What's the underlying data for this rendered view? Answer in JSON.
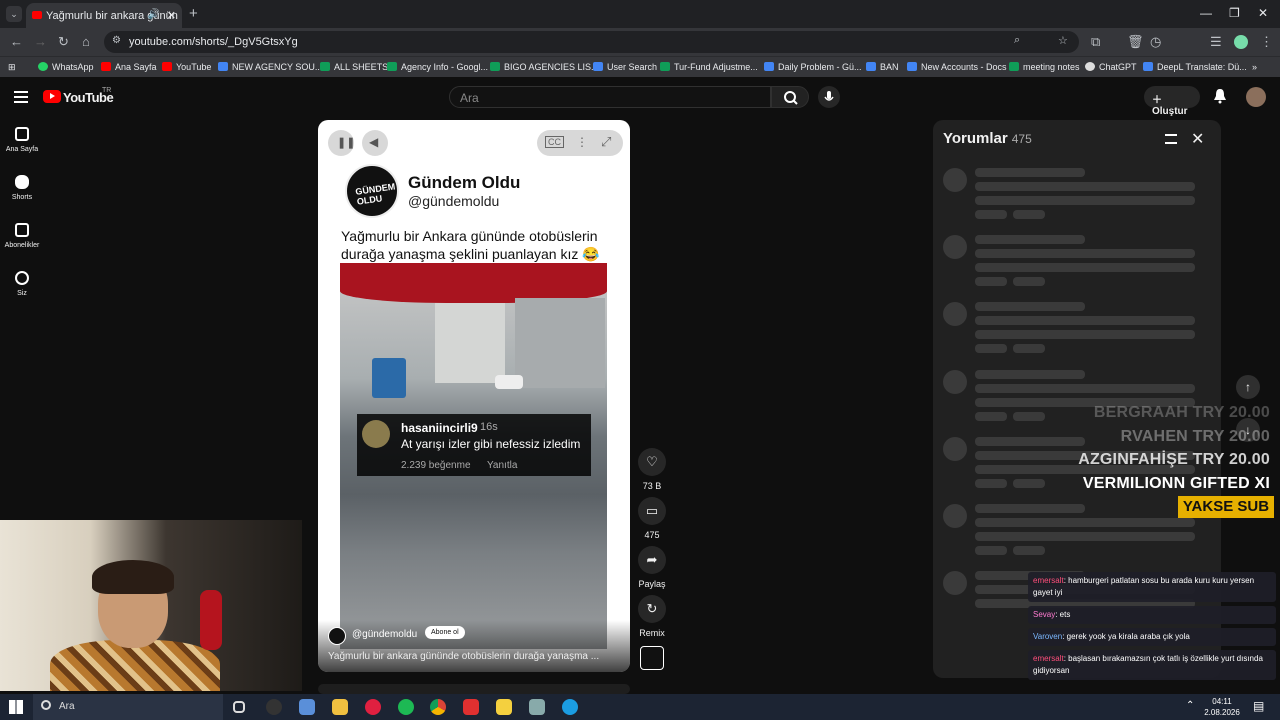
{
  "browser": {
    "tab_title": "Yağmurlu bir ankara günün",
    "url": "youtube.com/shorts/_DgV5GtsxYg",
    "bookmarks": [
      "WhatsApp",
      "Ana Sayfa",
      "YouTube",
      "NEW AGENCY SOU...",
      "ALL SHEETS",
      "Agency Info - Googl...",
      "BIGO AGENCIES LIS...",
      "User Search",
      "Tur-Fund Adjustme...",
      "Daily Problem - Gü...",
      "BAN",
      "New Accounts - Docs",
      "meeting notes",
      "ChatGPT",
      "DeepL Translate: Dü..."
    ]
  },
  "youtube": {
    "logo_text": "YouTube",
    "region": "TR",
    "search_placeholder": "Ara",
    "create_label": "Oluştur",
    "sidebar": [
      "Ana Sayfa",
      "Shorts",
      "Abonelikler",
      "Siz"
    ]
  },
  "short": {
    "channel_name": "Gündem Oldu",
    "channel_handle": "@gündemoldu",
    "logo_text": "GÜNDEM OLDU",
    "caption": "Yağmurlu bir Ankara gününde otobüslerin durağa yanaşma şeklini puanlayan kız 😂",
    "comment_user": "hasaniincirli9",
    "comment_time": "16s",
    "comment_text": "At yarışı izler gibi nefessiz izledim",
    "comment_likes": "2.239 beğenme",
    "comment_reply": "Yanıtla",
    "footer_handle": "@gündemoldu",
    "subscribe_label": "Abone ol",
    "footer_title": "Yağmurlu bir ankara gününde otobüslerin durağa yanaşma ..."
  },
  "actions": {
    "likes": "73 B",
    "comments": "475",
    "share": "Paylaş",
    "remix": "Remix"
  },
  "comments_panel": {
    "title": "Yorumlar",
    "count": "475"
  },
  "overlay": {
    "donors": [
      "BERGRAAH  TRY 20.00",
      "RVAHEN  TRY 20.00",
      "AZGINFAHİŞE  TRY 20.00",
      "VERMILIONN  GIFTED XI"
    ],
    "yakse": "YAKSE SUB",
    "chat": [
      {
        "user": "emersalt",
        "text": ": hamburgeri patlatan sosu bu arada kuru kuru yersen gayet iyi"
      },
      {
        "user": "Sevay",
        "text": ": ets"
      },
      {
        "user": "Varoven",
        "text": ": gerek yook ya kirala araba çık yola"
      },
      {
        "user": "emersalt",
        "text": ": başlasan bırakamazsın çok tatlı iş özellikle yurt dısında gidiyorsan"
      }
    ]
  },
  "taskbar": {
    "search": "Ara",
    "time": "04:11",
    "date": "2.08.2026"
  },
  "colors": {
    "accent": "#ff0000",
    "yakse": "#e6b000",
    "chat_user": "#ff4f7b"
  }
}
